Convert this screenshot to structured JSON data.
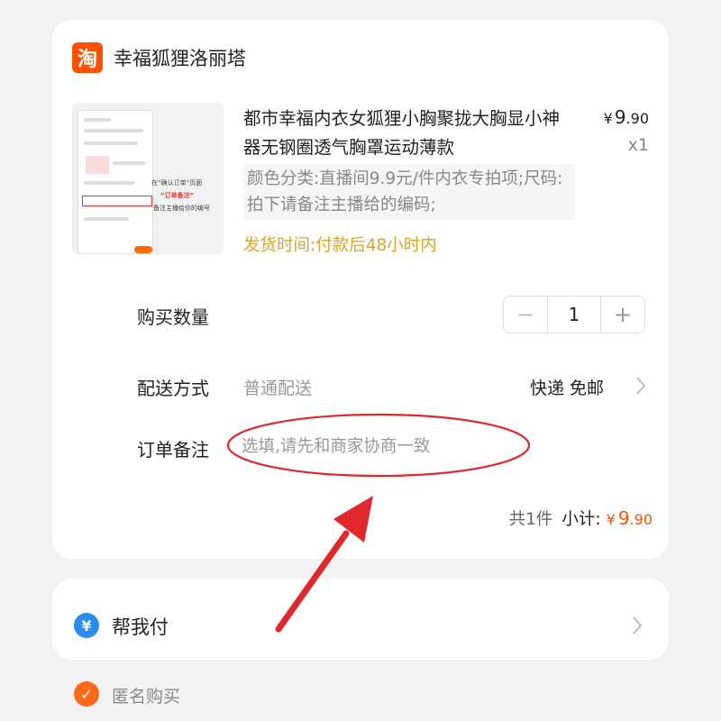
{
  "shop": {
    "logo_char": "淘",
    "name": "幸福狐狸洛丽塔"
  },
  "product": {
    "title": "都市幸福内衣女狐狸小胸聚拢大胸显小神器无钢圈透气胸罩运动薄款",
    "price_currency": "¥",
    "price_int": "9",
    "price_dec": ".90",
    "quantity_label": "x1",
    "spec": "颜色分类:直播间9.9元/件内衣专拍项;尺码:拍下请备注主播给的编码;",
    "shipping_time": "发货时间:付款后48小时内",
    "thumb_text_1": "在“确认订单”页面",
    "thumb_text_2": "“订单备注”",
    "thumb_text_3": "备注主播给你的编号"
  },
  "quantity": {
    "label": "购买数量",
    "minus": "−",
    "value": "1",
    "plus": "+"
  },
  "delivery": {
    "label": "配送方式",
    "value": "普通配送",
    "method": "快递 免邮"
  },
  "note": {
    "label": "订单备注",
    "placeholder": "选填,请先和商家协商一致"
  },
  "summary": {
    "count": "共1件",
    "subtotal_label": "小计:",
    "currency": "¥",
    "amount_int": "9",
    "amount_dec": ".90"
  },
  "pay_for_me": {
    "icon_char": "¥",
    "label": "帮我付"
  },
  "anonymous": {
    "check_char": "✓",
    "label": "匿名购买",
    "checked": true
  },
  "colors": {
    "accent": "#ff5000",
    "ship_time": "#d9a52b",
    "annotation": "#e0272b",
    "pay_icon": "#2a8cf0"
  },
  "icons": [
    "taobao-logo-icon",
    "chevron-right-icon",
    "yen-circle-icon",
    "checkmark-icon"
  ]
}
